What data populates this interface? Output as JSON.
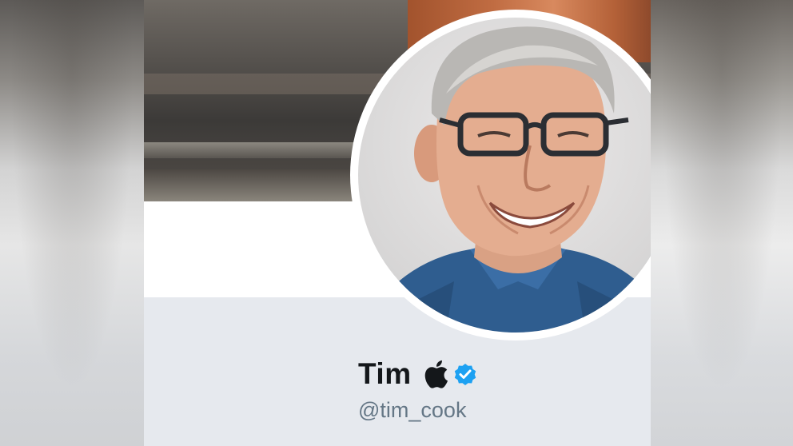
{
  "profile": {
    "display_name": "Tim",
    "handle": "@tim_cook",
    "verified": true,
    "name_emoji": "apple-logo-icon"
  },
  "colors": {
    "name_text": "#14171a",
    "handle_text": "#657786",
    "verified_badge": "#1da1f2",
    "card_background": "#e6e9ee"
  },
  "icons": [
    "apple-logo-icon",
    "verified-badge-icon"
  ]
}
